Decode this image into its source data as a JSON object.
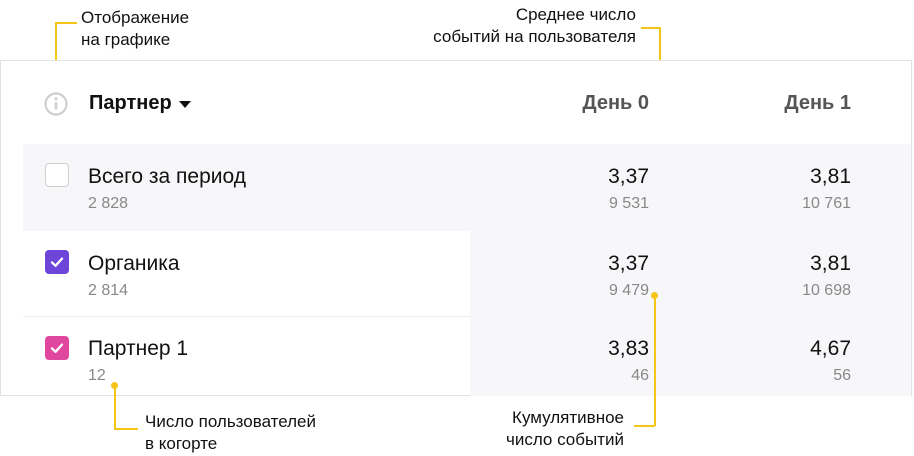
{
  "annotations": {
    "display_on_chart": [
      "Отображение",
      "на графике"
    ],
    "avg_events": [
      "Среднее число",
      "событий на пользователя"
    ],
    "cohort_users": [
      "Число пользователей",
      "в когорте"
    ],
    "cumulative_events": [
      "Кумулятивное",
      "число событий"
    ]
  },
  "colors": {
    "accent_line": "#f5c518",
    "checkbox_organic": "#6e45d9",
    "checkbox_partner": "#e0479e"
  },
  "table": {
    "header": {
      "title": "Партнер",
      "columns": [
        "День 0",
        "День 1"
      ]
    },
    "rows": [
      {
        "name": "Всего за период",
        "count": "2 828",
        "checked": false,
        "values": [
          {
            "avg": "3,37",
            "total": "9 531"
          },
          {
            "avg": "3,81",
            "total": "10 761"
          }
        ]
      },
      {
        "name": "Органика",
        "count": "2 814",
        "checked": true,
        "color": "#6e45d9",
        "values": [
          {
            "avg": "3,37",
            "total": "9 479"
          },
          {
            "avg": "3,81",
            "total": "10 698"
          }
        ]
      },
      {
        "name": "Партнер 1",
        "count": "12",
        "checked": true,
        "color": "#e0479e",
        "values": [
          {
            "avg": "3,83",
            "total": "46"
          },
          {
            "avg": "4,67",
            "total": "56"
          }
        ]
      }
    ]
  }
}
